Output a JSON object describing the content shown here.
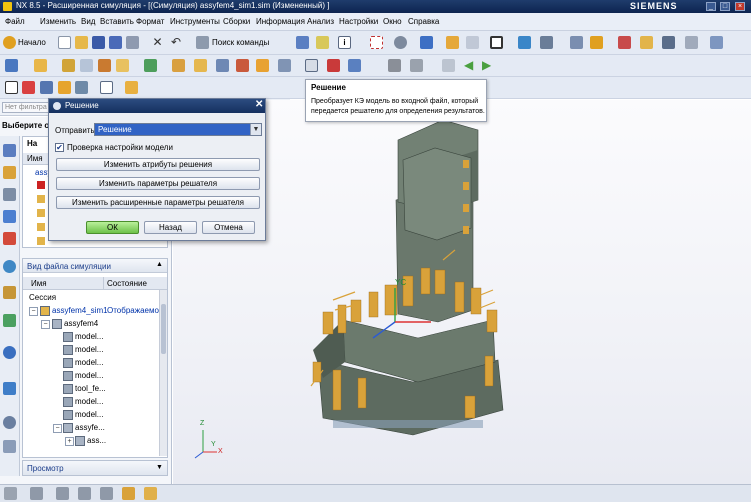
{
  "window": {
    "title": "NX 8.5 - Расширенная симуляция - [(Симуляция) assyfem4_sim1.sim (Измененный) ]",
    "brand": "SIEMENS",
    "controls": [
      "_",
      "□",
      "×"
    ]
  },
  "menu": {
    "items": [
      "Файл",
      "Изменить",
      "Вид",
      "Вставить",
      "Формат",
      "Инструменты",
      "Сборки",
      "Информация",
      "Анализ",
      "Настройки",
      "Окно",
      "Справка"
    ]
  },
  "toolbar": {
    "start_label": "Начало",
    "command_search_label": "Поиск команды"
  },
  "filter": {
    "label": "Нет фильтра"
  },
  "left_panel": {
    "nav_title": "Выберите опц",
    "nav_header_tab": "На",
    "name_column_short": "Имя",
    "top_tree_item": "assyf",
    "sim_file_view_title": "Вид файла симуляции",
    "columns": [
      "Имя",
      "Состояние"
    ],
    "session_label": "Сессия",
    "tree": [
      {
        "label": "assyfem4_sim1",
        "state": "Отображаемо",
        "level": 0
      },
      {
        "label": "assyfem4",
        "state": "",
        "level": 1
      },
      {
        "label": "model...",
        "state": "",
        "level": 2
      },
      {
        "label": "model...",
        "state": "",
        "level": 2
      },
      {
        "label": "model...",
        "state": "",
        "level": 2
      },
      {
        "label": "model...",
        "state": "",
        "level": 2
      },
      {
        "label": "tool_fe...",
        "state": "",
        "level": 2
      },
      {
        "label": "model...",
        "state": "",
        "level": 2
      },
      {
        "label": "model...",
        "state": "",
        "level": 2
      },
      {
        "label": "assyfe...",
        "state": "",
        "level": 2
      },
      {
        "label": "ass...",
        "state": "",
        "level": 3
      }
    ],
    "preview_title": "Просмотр"
  },
  "dialog": {
    "title": "Решение",
    "submit_label": "Отправить",
    "submit_value": "Решение",
    "check_model_label": "Проверка настройки модели",
    "buttons": [
      "Изменить атрибуты решения",
      "Изменить параметры решателя",
      "Изменить расширенные параметры решателя"
    ],
    "ok": "ОК",
    "back": "Назад",
    "cancel": "Отмена"
  },
  "tooltip": {
    "title": "Решение",
    "text_line1": "Преобразует КЭ модель во входной файл, который",
    "text_line2": "передается решателю для определения результатов."
  },
  "viewport": {
    "axis_labels": {
      "yc": "YC",
      "z": "Z",
      "y": "Y",
      "x": "X"
    }
  },
  "colors": {
    "model_gray": "#5d6b60",
    "model_gold": "#d9a23a",
    "title_bar": "#15305f",
    "dropdown_selected": "#3163c5"
  }
}
